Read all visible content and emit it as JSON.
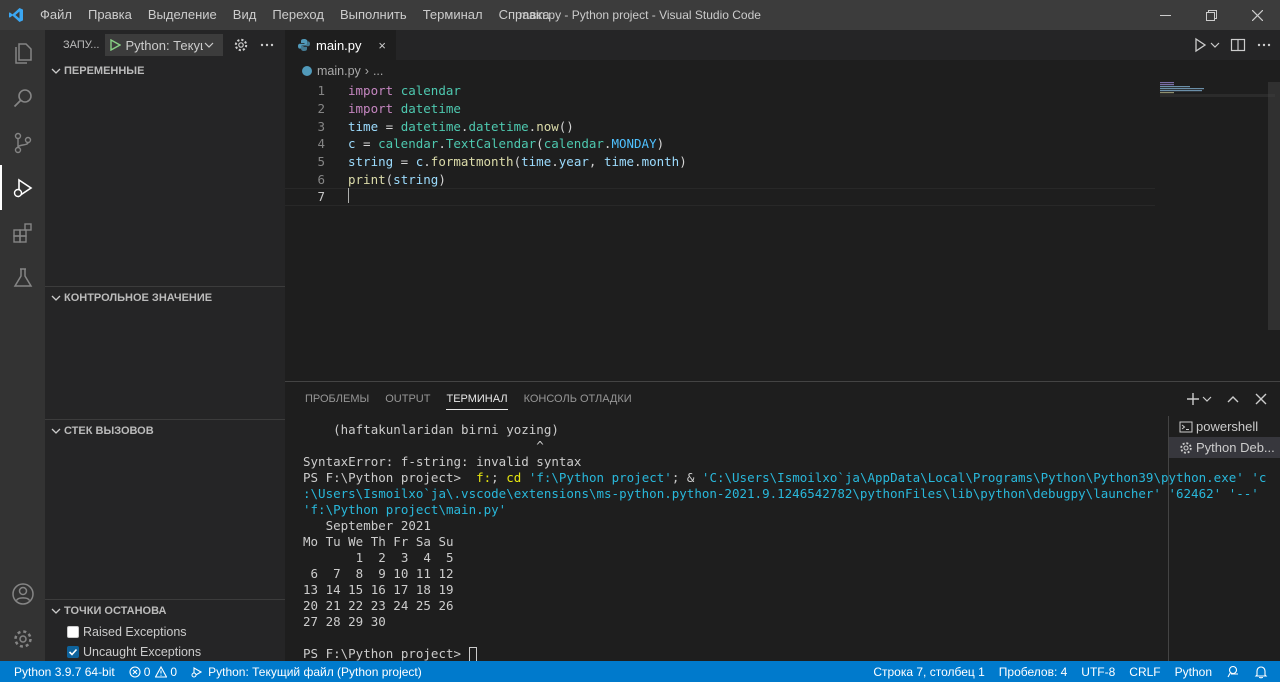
{
  "window": {
    "title": "main.py - Python project - Visual Studio Code",
    "menu": [
      "Файл",
      "Правка",
      "Выделение",
      "Вид",
      "Переход",
      "Выполнить",
      "Терминал",
      "Справка"
    ]
  },
  "activity_bar": {
    "items": [
      "files-icon",
      "search-icon",
      "source-control-icon",
      "run-debug-icon",
      "extensions-icon",
      "testing-icon"
    ],
    "bottom": [
      "account-icon",
      "settings-gear-icon"
    ]
  },
  "sidebar": {
    "run_label": "ЗАПУ...",
    "launch_config": "Python: Текущ",
    "sections": {
      "variables": "ПЕРЕМЕННЫЕ",
      "watch": "КОНТРОЛЬНОЕ ЗНАЧЕНИЕ",
      "call_stack": "СТЕК ВЫЗОВОВ",
      "breakpoints": "ТОЧКИ ОСТАНОВА"
    },
    "breakpoints": [
      {
        "label": "Raised Exceptions",
        "checked": false
      },
      {
        "label": "Uncaught Exceptions",
        "checked": true
      }
    ]
  },
  "editor": {
    "tab": {
      "label": "main.py",
      "close": "×"
    },
    "breadcrumb": {
      "file": "main.py",
      "sep": "›",
      "rest": "..."
    },
    "lines": [
      {
        "n": "1",
        "tokens": [
          [
            "kw",
            "import"
          ],
          [
            "op",
            " "
          ],
          [
            "mod",
            "calendar"
          ]
        ]
      },
      {
        "n": "2",
        "tokens": [
          [
            "kw",
            "import"
          ],
          [
            "op",
            " "
          ],
          [
            "mod",
            "datetime"
          ]
        ]
      },
      {
        "n": "3",
        "tokens": [
          [
            "var",
            "time"
          ],
          [
            "op",
            " = "
          ],
          [
            "mod",
            "datetime"
          ],
          [
            "op",
            "."
          ],
          [
            "cls",
            "datetime"
          ],
          [
            "op",
            "."
          ],
          [
            "fn",
            "now"
          ],
          [
            "op",
            "()"
          ]
        ]
      },
      {
        "n": "4",
        "tokens": [
          [
            "var",
            "c"
          ],
          [
            "op",
            " = "
          ],
          [
            "mod",
            "calendar"
          ],
          [
            "op",
            "."
          ],
          [
            "cls",
            "TextCalendar"
          ],
          [
            "op",
            "("
          ],
          [
            "mod",
            "calendar"
          ],
          [
            "op",
            "."
          ],
          [
            "const",
            "MONDAY"
          ],
          [
            "op",
            ")"
          ]
        ]
      },
      {
        "n": "5",
        "tokens": [
          [
            "var",
            "string"
          ],
          [
            "op",
            " = "
          ],
          [
            "var",
            "c"
          ],
          [
            "op",
            "."
          ],
          [
            "fn",
            "formatmonth"
          ],
          [
            "op",
            "("
          ],
          [
            "var",
            "time"
          ],
          [
            "op",
            "."
          ],
          [
            "var",
            "year"
          ],
          [
            "op",
            ", "
          ],
          [
            "var",
            "time"
          ],
          [
            "op",
            "."
          ],
          [
            "var",
            "month"
          ],
          [
            "op",
            ")"
          ]
        ]
      },
      {
        "n": "6",
        "tokens": [
          [
            "fn",
            "print"
          ],
          [
            "op",
            "("
          ],
          [
            "var",
            "string"
          ],
          [
            "op",
            ")"
          ]
        ]
      },
      {
        "n": "7",
        "tokens": []
      }
    ]
  },
  "panel": {
    "tabs": [
      "ПРОБЛЕМЫ",
      "OUTPUT",
      "ТЕРМИНАЛ",
      "КОНСОЛЬ ОТЛАДКИ"
    ],
    "active_tab": 2,
    "terminal_lines": [
      [
        [
          "",
          "    (haftakunlaridan birni yozing)"
        ]
      ],
      [
        [
          "",
          "                               ^"
        ]
      ],
      [
        [
          "",
          "SyntaxError: f-string: invalid syntax"
        ]
      ],
      [
        [
          "",
          "PS F:\\Python project>  "
        ],
        [
          "t-yellow",
          "f:"
        ],
        [
          "",
          "; "
        ],
        [
          "t-yellow",
          "cd"
        ],
        [
          "",
          " "
        ],
        [
          "t-cyan",
          "'f:\\Python project'"
        ],
        [
          "",
          "; & "
        ],
        [
          "t-cyan",
          "'C:\\Users\\Ismoilxo`ja\\AppData\\Local\\Programs\\Python\\Python39\\python.exe'"
        ],
        [
          "",
          " "
        ],
        [
          "t-cyan",
          "'c"
        ]
      ],
      [
        [
          "t-cyan",
          ":\\Users\\Ismoilxo`ja\\.vscode\\extensions\\ms-python.python-2021.9.1246542782\\pythonFiles\\lib\\python\\debugpy\\launcher'"
        ],
        [
          "",
          " "
        ],
        [
          "t-cyan",
          "'62462'"
        ],
        [
          "",
          " "
        ],
        [
          "t-cyan",
          "'--'"
        ]
      ],
      [
        [
          "t-cyan",
          "'f:\\Python project\\main.py'"
        ]
      ],
      [
        [
          "",
          "   September 2021"
        ]
      ],
      [
        [
          "",
          "Mo Tu We Th Fr Sa Su"
        ]
      ],
      [
        [
          "",
          "       1  2  3  4  5"
        ]
      ],
      [
        [
          "",
          " 6  7  8  9 10 11 12"
        ]
      ],
      [
        [
          "",
          "13 14 15 16 17 18 19"
        ]
      ],
      [
        [
          "",
          "20 21 22 23 24 25 26"
        ]
      ],
      [
        [
          "",
          "27 28 29 30"
        ]
      ],
      [
        [
          "",
          ""
        ]
      ],
      [
        [
          "",
          "PS F:\\Python project> "
        ]
      ]
    ],
    "terminals": [
      {
        "label": "powershell",
        "icon": "terminal-icon",
        "selected": false
      },
      {
        "label": "Python Deb...",
        "icon": "debug-gear-icon",
        "selected": true
      }
    ]
  },
  "status_bar": {
    "python_version": "Python 3.9.7 64-bit",
    "errors": "0",
    "warnings": "0",
    "debug_config": "Python: Текущий файл (Python project)",
    "cursor_position": "Строка 7, столбец 1",
    "indentation": "Пробелов: 4",
    "encoding": "UTF-8",
    "eol": "CRLF",
    "language": "Python"
  },
  "colors": {
    "status_bar": "#007acc",
    "title_bar": "#3c3c3c",
    "activity_bar": "#333333",
    "sidebar": "#252526",
    "editor": "#1e1e1e"
  }
}
